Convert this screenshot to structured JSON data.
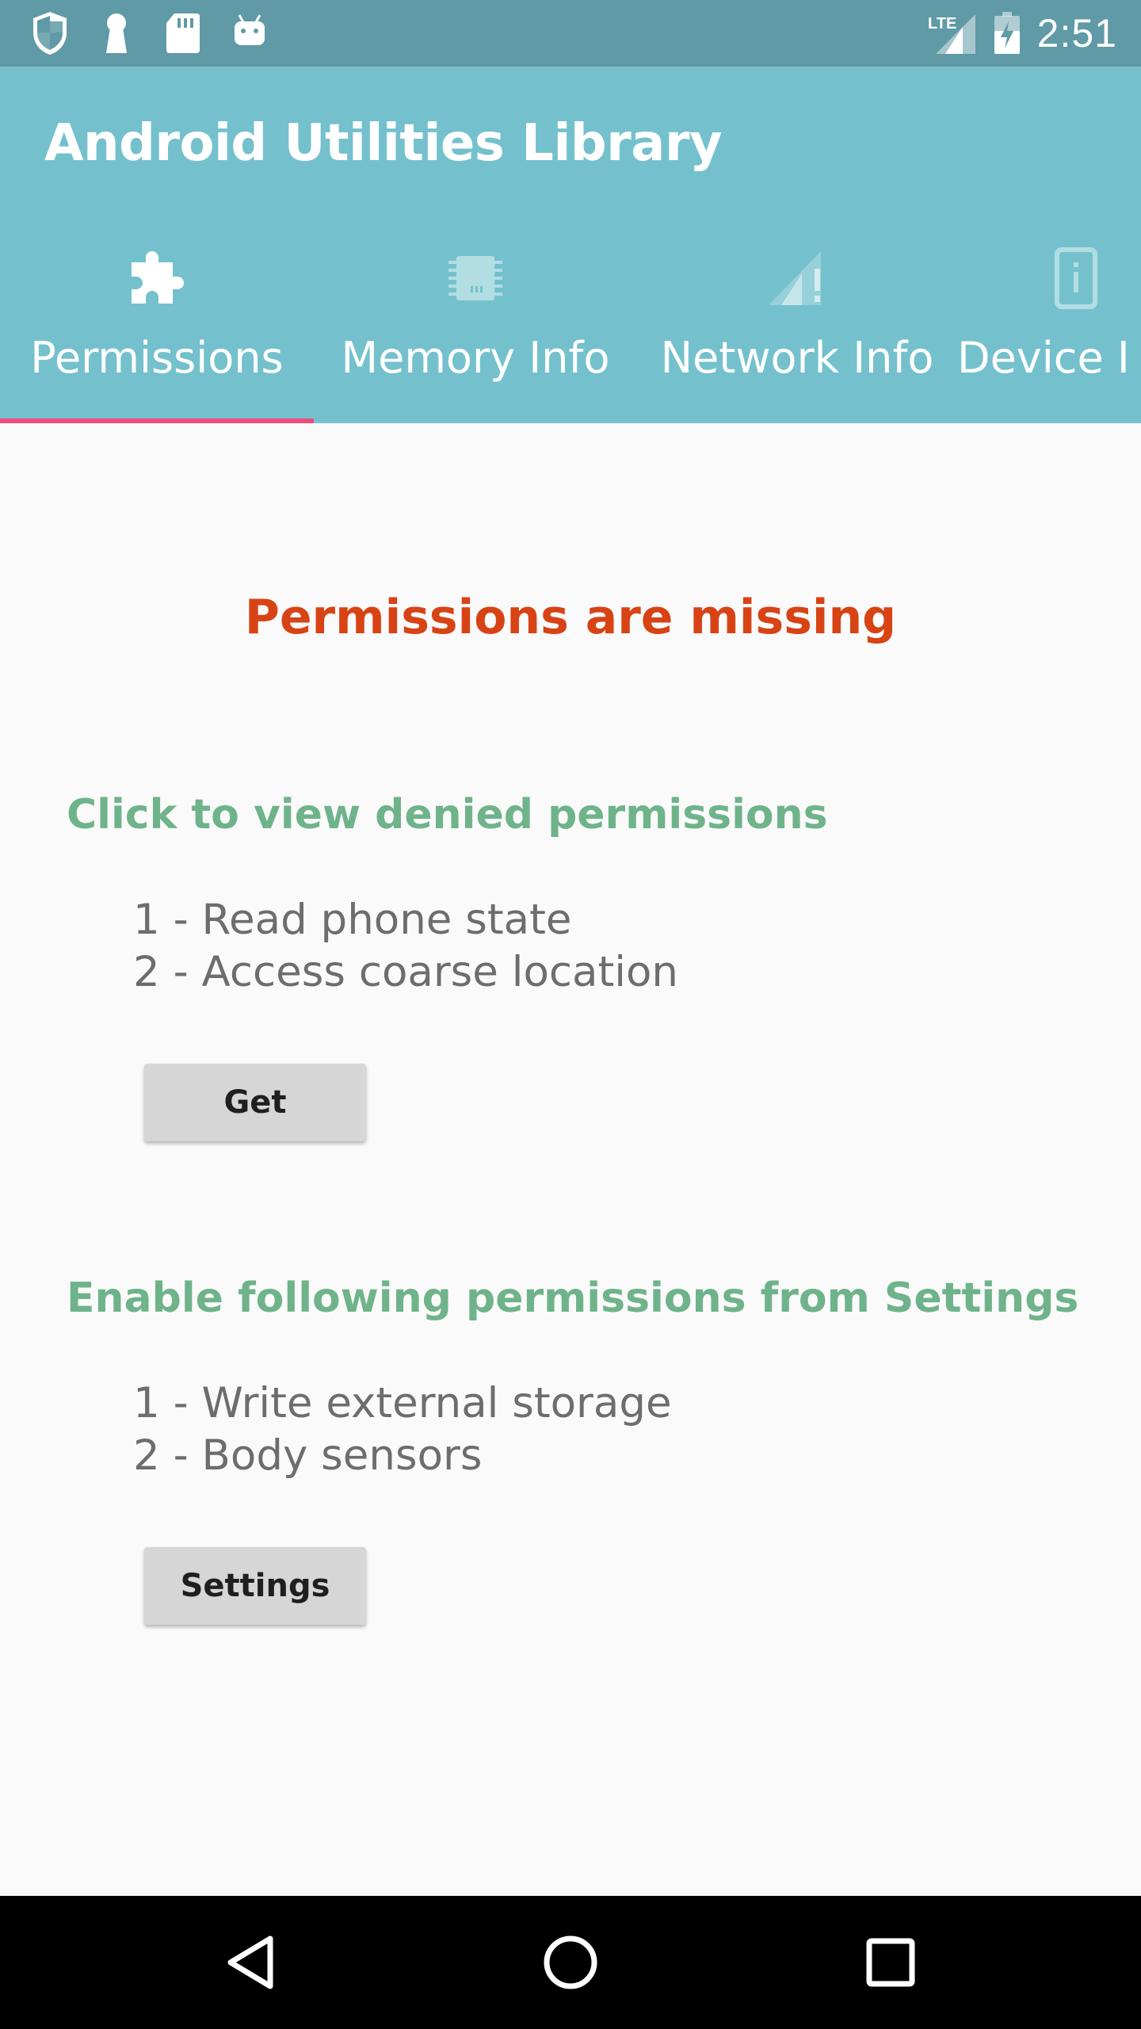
{
  "status_bar": {
    "time": "2:51",
    "network": "LTE",
    "left_icons": [
      "shield-icon",
      "keyhole-icon",
      "sd-card-icon",
      "android-icon"
    ],
    "bg_color": "#5f9aa6"
  },
  "app_bar": {
    "title": "Android Utilities Library",
    "bg_color": "#74c1cd"
  },
  "tabs": [
    {
      "label": "Permissions",
      "icon": "puzzle-icon",
      "active": true
    },
    {
      "label": "Memory Info",
      "icon": "chip-icon",
      "active": false
    },
    {
      "label": "Network Info",
      "icon": "signal-alert-icon",
      "active": false
    },
    {
      "label": "Device I",
      "icon": "phone-info-icon",
      "active": false
    }
  ],
  "tab_indicator_color": "#ef4b7c",
  "content": {
    "status_title": "Permissions are missing",
    "status_color": "#d84315",
    "denied_section": {
      "heading": "Click to view denied permissions",
      "items": [
        "1 - Read phone state",
        "2 - Access coarse location"
      ],
      "button_label": "Get"
    },
    "settings_section": {
      "heading": "Enable following permissions from Settings",
      "items": [
        "1 - Write external storage",
        "2 - Body sensors"
      ],
      "button_label": "Settings"
    },
    "heading_color": "#6fb38b"
  },
  "nav_bar": {
    "buttons": [
      "back-icon",
      "home-icon",
      "recents-icon"
    ]
  }
}
